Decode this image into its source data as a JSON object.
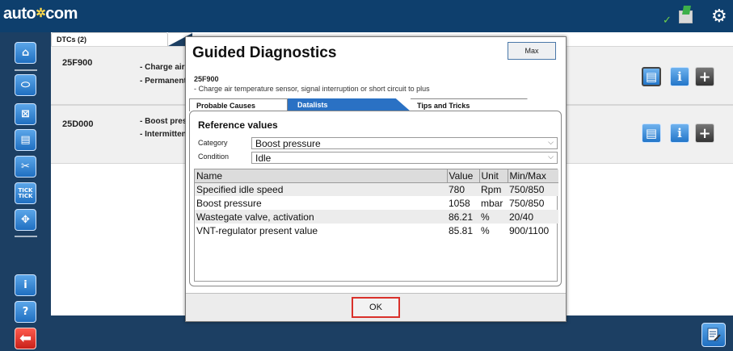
{
  "app": {
    "logo_text": "auto",
    "logo_symbol": "✲",
    "logo_text2": "com"
  },
  "status": {
    "check_glyph": "✓",
    "gear_glyph": "⚙"
  },
  "sidebar": {
    "items": [
      {
        "name": "home",
        "glyph": "⌂"
      },
      {
        "name": "engine",
        "glyph": "⬭"
      },
      {
        "name": "disabled-unit",
        "glyph": "⊠"
      },
      {
        "name": "document",
        "glyph": "▤"
      },
      {
        "name": "tools",
        "glyph": "✂"
      },
      {
        "name": "tick-tick",
        "label_top": "TICK",
        "label_bottom": "TICK"
      },
      {
        "name": "network",
        "glyph": "✥"
      },
      {
        "name": "info",
        "glyph": "i"
      },
      {
        "name": "help",
        "glyph": "?"
      },
      {
        "name": "back",
        "glyph": "⬅"
      }
    ]
  },
  "main": {
    "tab_label": "DTCs (2)",
    "rows": [
      {
        "code": "25F900",
        "desc_line1": "- Charge air",
        "desc_line2": "- Permanent"
      },
      {
        "code": "25D000",
        "desc_line1": "- Boost pres",
        "desc_line2": "- Intermitten"
      }
    ],
    "row_buttons": {
      "info_glyph": "i",
      "add_glyph": "+"
    }
  },
  "dialog": {
    "title": "Guided Diagnostics",
    "max_label": "Max",
    "code": "25F900",
    "description": "- Charge air temperature sensor, signal interruption or short circuit to plus",
    "tabs": [
      "Probable Causes",
      "Datalists",
      "Tips and Tricks"
    ],
    "active_tab": "Datalists",
    "reference_title": "Reference values",
    "category_label": "Category",
    "category_value": "Boost pressure",
    "condition_label": "Condition",
    "condition_value": "Idle",
    "table": {
      "headers": [
        "Name",
        "Value",
        "Unit",
        "Min/Max"
      ],
      "rows": [
        [
          "Specified idle speed",
          "780",
          "Rpm",
          "750/850"
        ],
        [
          "Boost pressure",
          "1058",
          "mbar",
          "750/850"
        ],
        [
          "Wastegate valve, activation",
          "86.21",
          "%",
          "20/40"
        ],
        [
          "VNT-regulator present value",
          "85.81",
          "%",
          "900/1100"
        ]
      ]
    },
    "ok_label": "OK"
  },
  "colors": {
    "topbar": "#0e3f6d",
    "background": "#1c3f63",
    "accent_blue": "#2a71c4",
    "ok_border": "#d9312b",
    "back_red": "#c8211a"
  }
}
